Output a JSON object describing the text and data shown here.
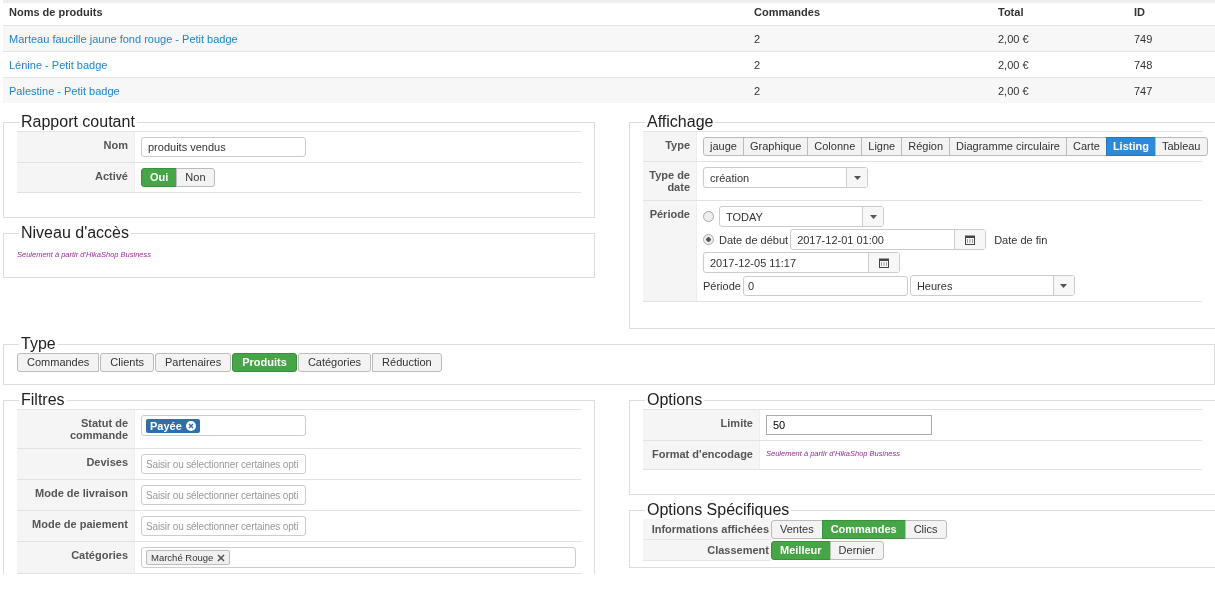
{
  "products_table": {
    "columns": [
      "Noms de produits",
      "Commandes",
      "Total",
      "ID"
    ],
    "rows": [
      {
        "name": "Marteau faucille jaune fond rouge - Petit badge",
        "orders": "2",
        "total": "2,00 €",
        "id": "749"
      },
      {
        "name": "Lénine - Petit badge",
        "orders": "2",
        "total": "2,00 €",
        "id": "748"
      },
      {
        "name": "Palestine - Petit badge",
        "orders": "2",
        "total": "2,00 €",
        "id": "747"
      }
    ]
  },
  "rows": [
    {
      "left": [
        {
          "title": "Rapport coutant",
          "kind": "form",
          "fields": [
            {
              "label": "Nom",
              "kind": "text",
              "value": "produits vendus"
            },
            {
              "label": "Activé",
              "kind": "toggle",
              "options": [
                {
                  "label": "Oui",
                  "selected": true
                },
                {
                  "label": "Non",
                  "selected": false
                }
              ]
            }
          ]
        },
        {
          "title": "Niveau d'accès",
          "kind": "note",
          "note": "Seulement à partir d'HikaShop Business"
        }
      ],
      "right": [
        {
          "title": "Affichage",
          "kind": "form",
          "fields": [
            {
              "label": "Type",
              "kind": "picker",
              "options": [
                {
                  "label": "jauge",
                  "selected": false
                },
                {
                  "label": "Graphique",
                  "selected": false
                },
                {
                  "label": "Colonne",
                  "selected": false
                },
                {
                  "label": "Ligne",
                  "selected": false
                },
                {
                  "label": "Région",
                  "selected": false
                },
                {
                  "label": "Diagramme circulaire",
                  "selected": false
                },
                {
                  "label": "Carte",
                  "selected": false
                },
                {
                  "label": "Listing",
                  "selected": true
                },
                {
                  "label": "Tableau",
                  "selected": false
                }
              ]
            },
            {
              "label": "Type de date",
              "kind": "select",
              "value": "création"
            },
            {
              "label": "Période",
              "kind": "period",
              "preset": {
                "selected": false,
                "value": "TODAY"
              },
              "range": {
                "selected": true,
                "start_label": "Date de début",
                "start": "2017-12-01 01:00",
                "end_label": "Date de fin",
                "end": "2017-12-05 11:17"
              },
              "duration": {
                "label": "Période",
                "value": "0",
                "unit": "Heures"
              }
            }
          ]
        }
      ]
    },
    {
      "full": [
        {
          "title": "Type",
          "kind": "choices",
          "options": [
            {
              "label": "Commandes",
              "selected": false
            },
            {
              "label": "Clients",
              "selected": false
            },
            {
              "label": "Partenaires",
              "selected": false
            },
            {
              "label": "Produits",
              "selected": true
            },
            {
              "label": "Catégories",
              "selected": false
            },
            {
              "label": "Réduction",
              "selected": false
            }
          ]
        }
      ]
    },
    {
      "left": [
        {
          "title": "Filtres",
          "kind": "form",
          "fields": [
            {
              "label": "Statut de commande",
              "kind": "status-tags",
              "tags": [
                "Payée"
              ]
            },
            {
              "label": "Devises",
              "kind": "multiselect",
              "placeholder": "Saisir ou sélectionner certaines opti"
            },
            {
              "label": "Mode de livraison",
              "kind": "multiselect",
              "placeholder": "Saisir ou sélectionner certaines opti"
            },
            {
              "label": "Mode de paiement",
              "kind": "multiselect",
              "placeholder": "Saisir ou sélectionner certaines opti"
            },
            {
              "label": "Catégories",
              "kind": "tags",
              "tags": [
                "Marché Rouge"
              ]
            }
          ]
        }
      ],
      "right": [
        {
          "title": "Options",
          "kind": "form",
          "fields": [
            {
              "label": "Limite",
              "kind": "text",
              "value": "50"
            },
            {
              "label": "Format d'encodage",
              "kind": "note",
              "note": "Seulement à partir d'HikaShop Business"
            }
          ]
        },
        {
          "title": "Options Spécifiques",
          "kind": "compact",
          "fields": [
            {
              "label": "Informations affichées",
              "kind": "toggle",
              "options": [
                {
                  "label": "Ventes",
                  "selected": false
                },
                {
                  "label": "Commandes",
                  "selected": true
                },
                {
                  "label": "Clics",
                  "selected": false
                }
              ]
            },
            {
              "label": "Classement",
              "kind": "toggle",
              "options": [
                {
                  "label": "Meilleur",
                  "selected": true
                },
                {
                  "label": "Dernier",
                  "selected": false
                }
              ]
            }
          ]
        }
      ]
    }
  ]
}
